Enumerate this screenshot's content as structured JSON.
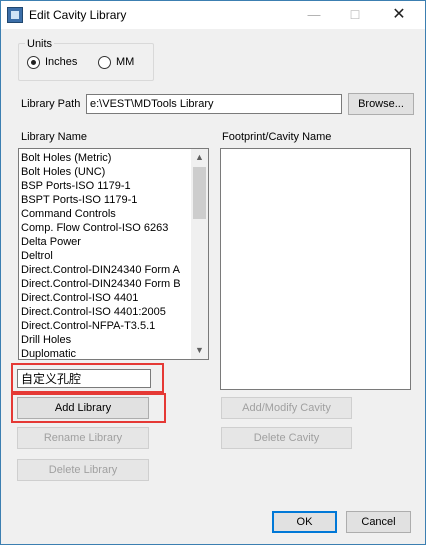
{
  "window": {
    "title": "Edit Cavity Library",
    "close_glyph": "✕",
    "max_glyph": "☐",
    "min_glyph": "—"
  },
  "units": {
    "legend": "Units",
    "options": [
      {
        "label": "Inches",
        "checked": true
      },
      {
        "label": "MM",
        "checked": false
      }
    ]
  },
  "library_path": {
    "label": "Library Path",
    "value": "e:\\VEST\\MDTools Library",
    "browse_label": "Browse..."
  },
  "library_list": {
    "header": "Library Name",
    "items": [
      "Bolt Holes (Metric)",
      "Bolt Holes (UNC)",
      "BSP Ports-ISO 1179-1",
      "BSPT Ports-ISO 1179-1",
      "Command Controls",
      "Comp. Flow Control-ISO 6263",
      "Delta Power",
      "Deltrol",
      "Direct.Control-DIN24340 Form A",
      "Direct.Control-DIN24340 Form B",
      "Direct.Control-ISO 4401",
      "Direct.Control-ISO 4401:2005",
      "Direct.Control-NFPA-T3.5.1",
      "Drill Holes",
      "Duplomatic"
    ],
    "scroll_position_fraction": 0.0
  },
  "footprint_list": {
    "header": "Footprint/Cavity Name",
    "items": []
  },
  "new_library_input": {
    "value": "自定义孔腔"
  },
  "buttons": {
    "add_library": "Add Library",
    "rename_library": "Rename Library",
    "delete_library": "Delete Library",
    "add_modify_cavity": "Add/Modify Cavity",
    "delete_cavity": "Delete Cavity",
    "ok": "OK",
    "cancel": "Cancel"
  },
  "colors": {
    "highlight": "#e53935",
    "accent": "#0078d7"
  }
}
